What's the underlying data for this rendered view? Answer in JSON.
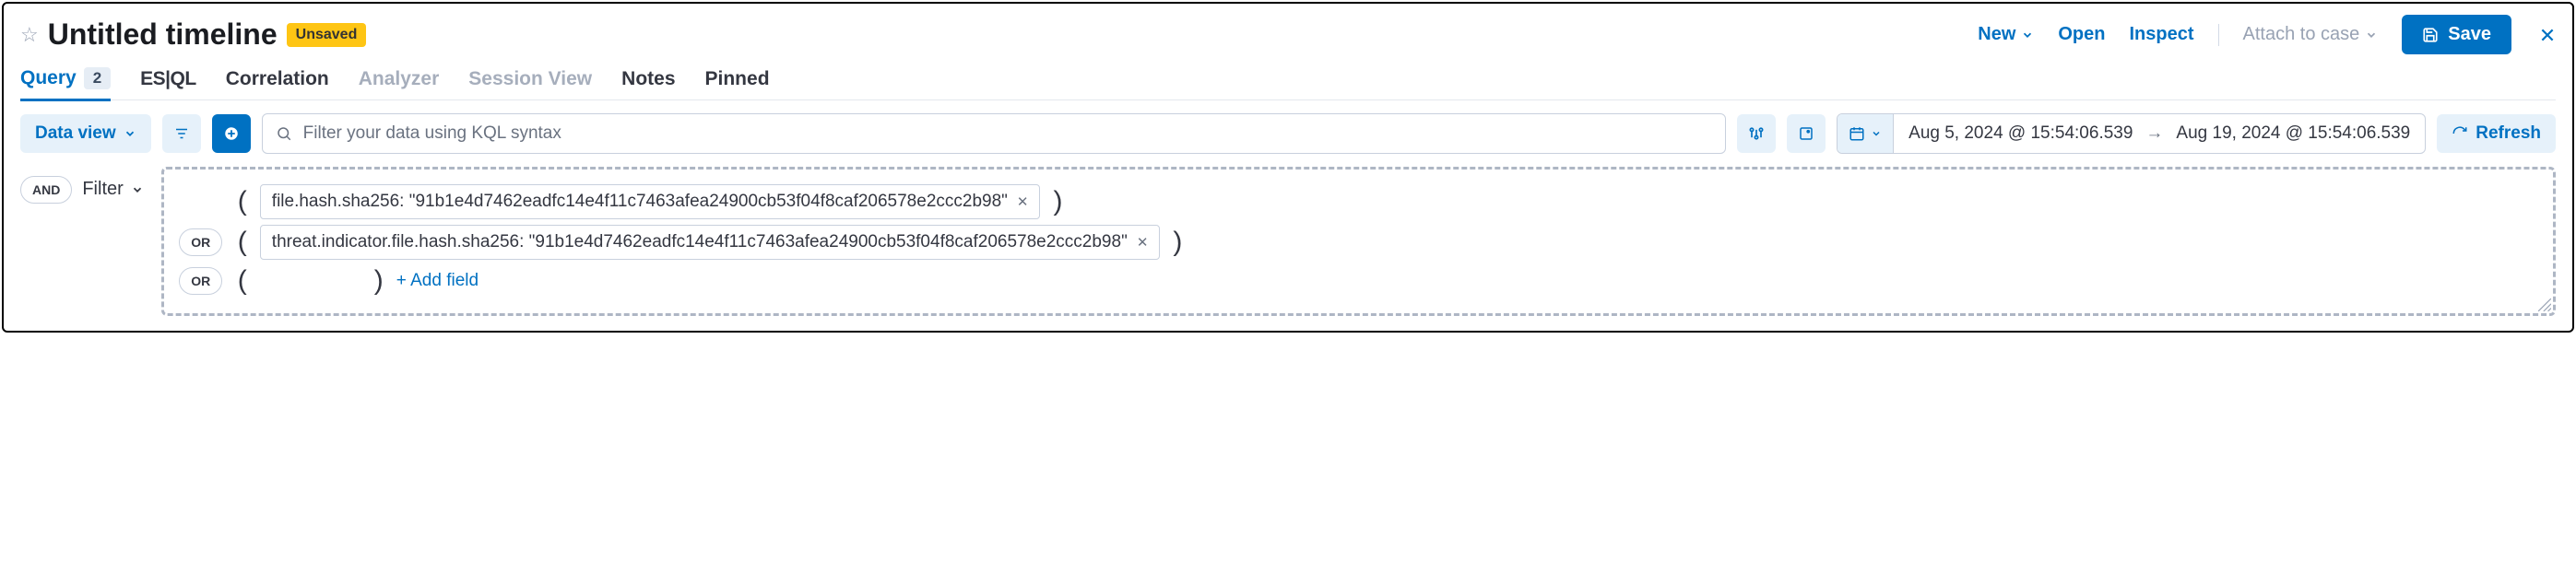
{
  "header": {
    "title": "Untitled timeline",
    "badge": "Unsaved",
    "new_label": "New",
    "open_label": "Open",
    "inspect_label": "Inspect",
    "attach_label": "Attach to case",
    "save_label": "Save"
  },
  "tabs": {
    "query": "Query",
    "query_count": "2",
    "esql": "ES|QL",
    "correlation": "Correlation",
    "analyzer": "Analyzer",
    "session_view": "Session View",
    "notes": "Notes",
    "pinned": "Pinned"
  },
  "toolbar": {
    "dataview_label": "Data view",
    "kql_placeholder": "Filter your data using KQL syntax",
    "date_from": "Aug 5, 2024 @ 15:54:06.539",
    "date_to": "Aug 19, 2024 @ 15:54:06.539",
    "refresh_label": "Refresh"
  },
  "builder": {
    "and_label": "AND",
    "filter_label": "Filter",
    "or_label": "OR",
    "add_field": "+ Add field",
    "rows": [
      {
        "chip": "file.hash.sha256: \"91b1e4d7462eadfc14e4f11c7463afea24900cb53f04f8caf206578e2ccc2b98\""
      },
      {
        "chip": "threat.indicator.file.hash.sha256: \"91b1e4d7462eadfc14e4f11c7463afea24900cb53f04f8caf206578e2ccc2b98\""
      }
    ]
  }
}
